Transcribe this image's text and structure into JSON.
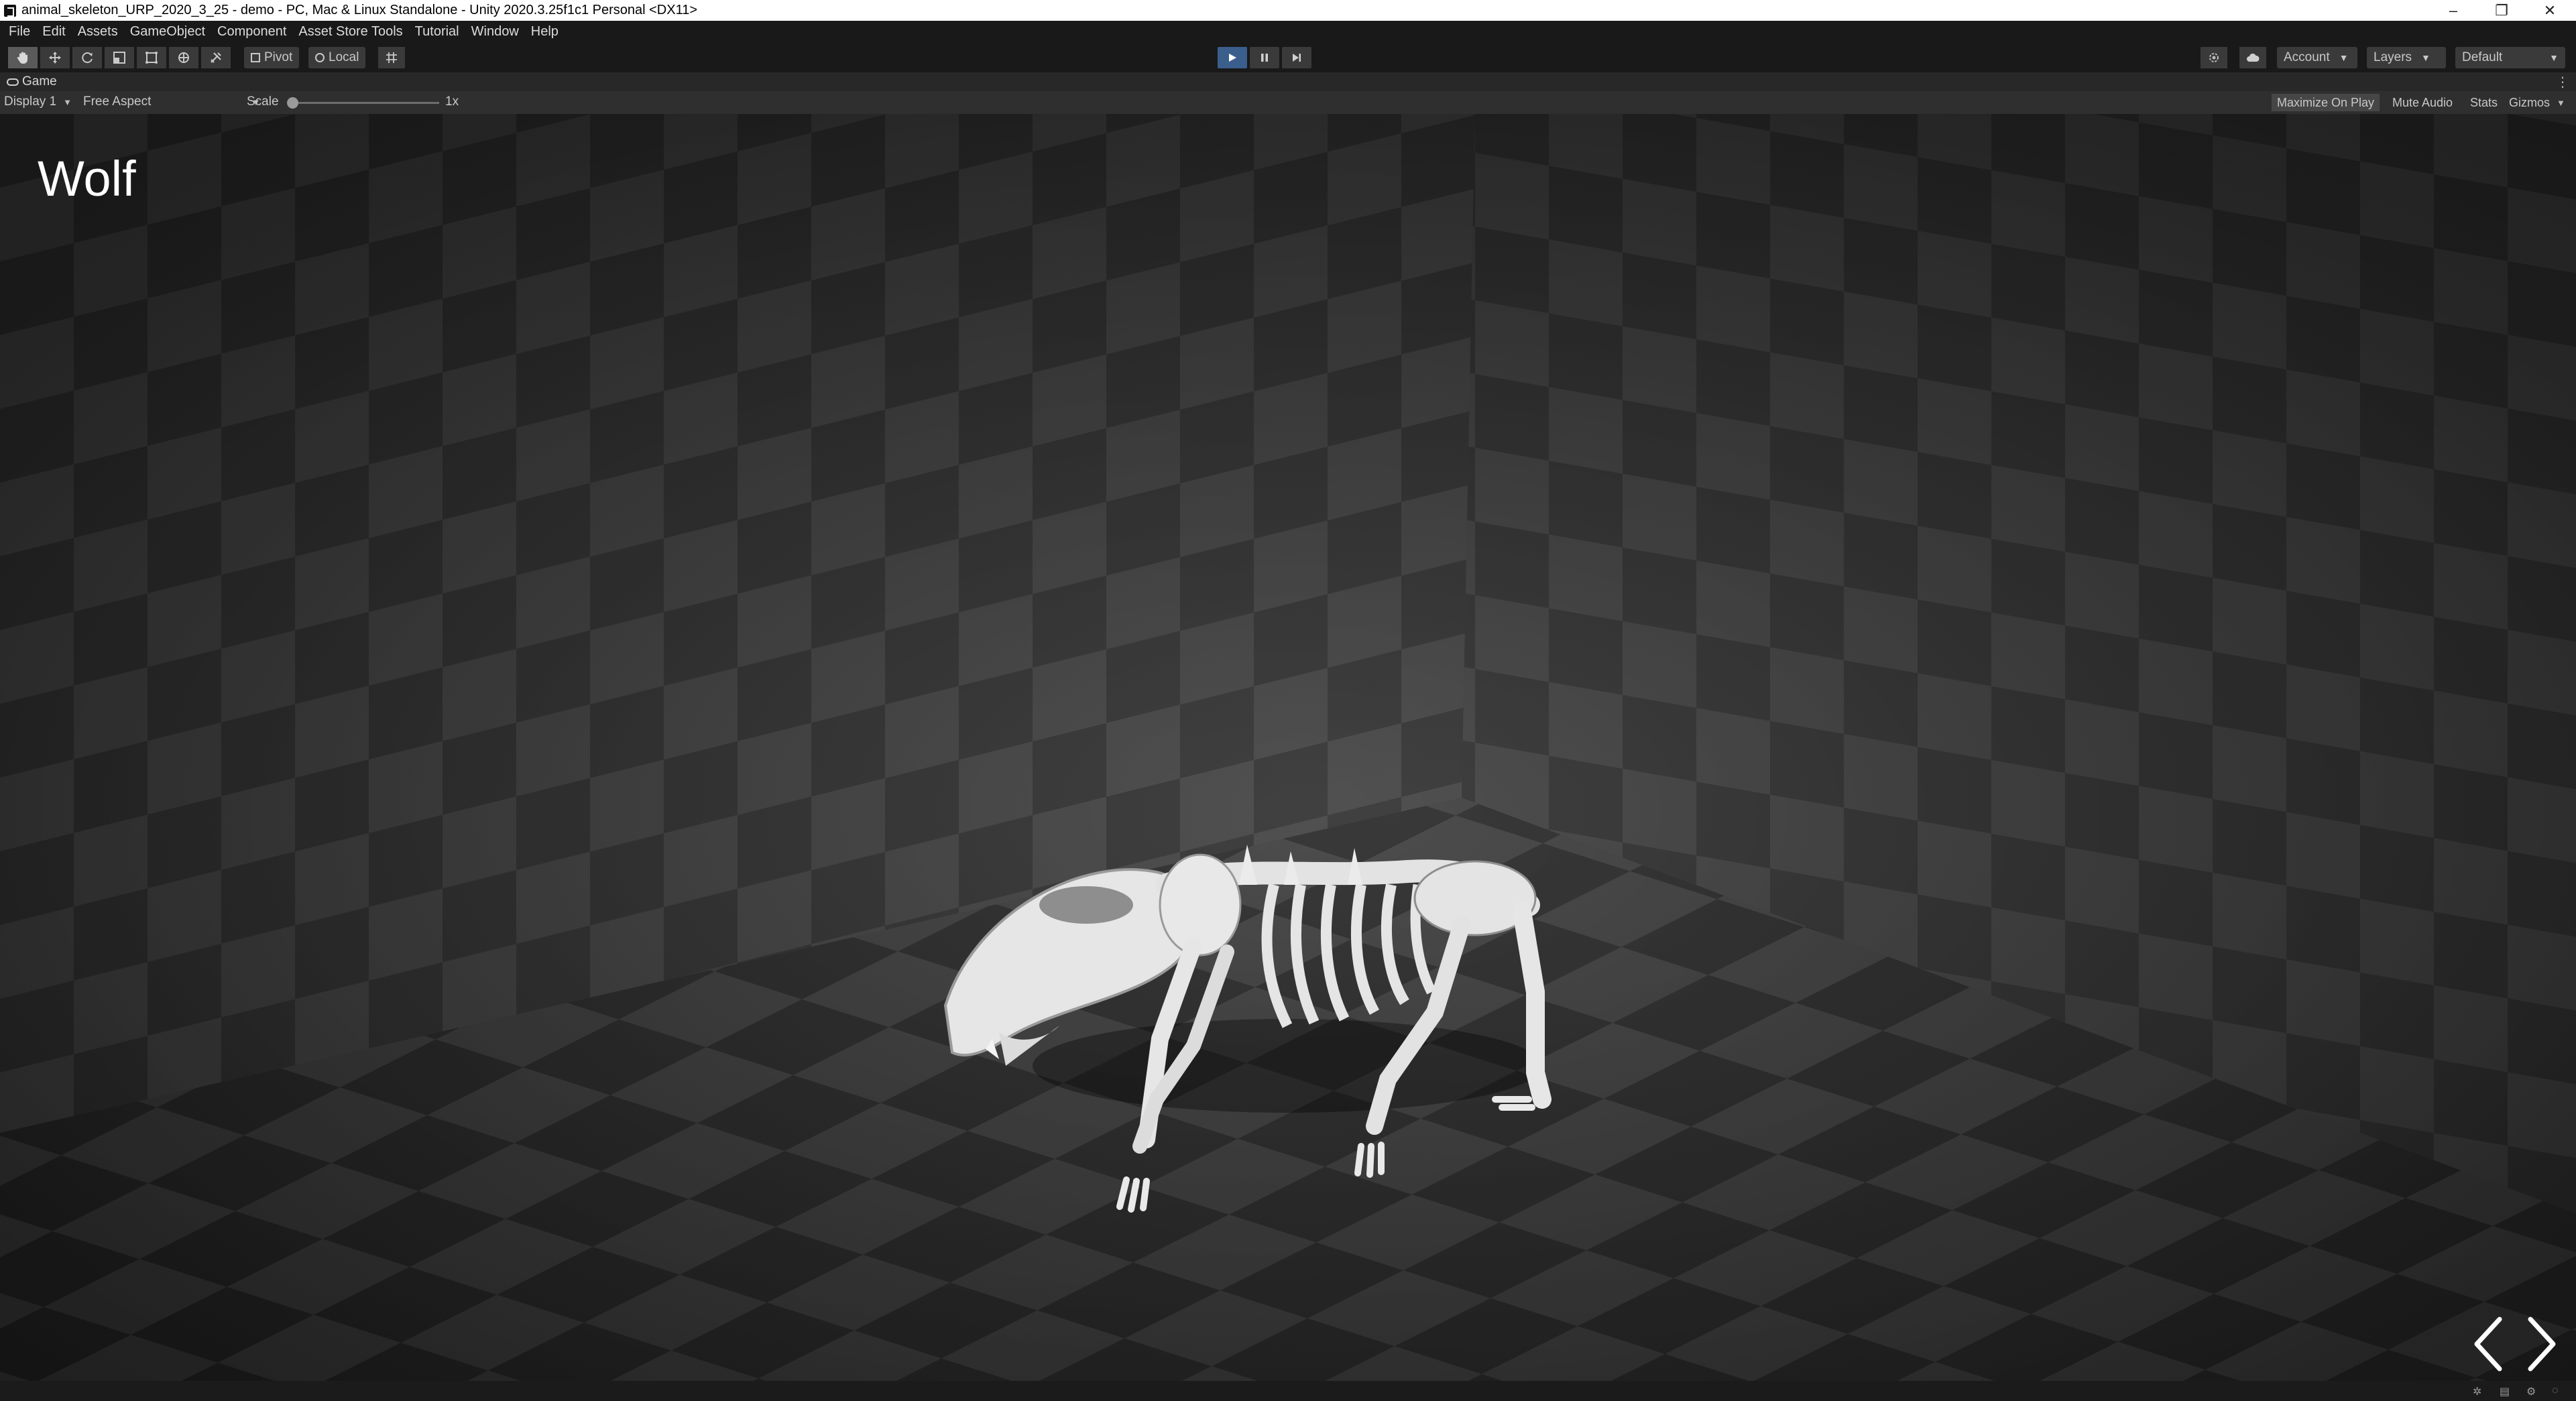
{
  "window": {
    "title": "animal_skeleton_URP_2020_3_25 - demo - PC, Mac & Linux Standalone - Unity 2020.3.25f1c1 Personal <DX11>",
    "controls": {
      "minimize": "–",
      "restore": "❐",
      "close": "✕"
    }
  },
  "menu": {
    "items": [
      "File",
      "Edit",
      "Assets",
      "GameObject",
      "Component",
      "Asset Store Tools",
      "Tutorial",
      "Window",
      "Help"
    ]
  },
  "toolbar": {
    "tools": [
      "hand-tool-icon",
      "move-tool-icon",
      "rotate-tool-icon",
      "scale-tool-icon",
      "rect-tool-icon",
      "transform-tool-icon",
      "custom-tool-icon"
    ],
    "pivot_label": "Pivot",
    "local_label": "Local",
    "account_label": "Account",
    "layers_label": "Layers",
    "layout_label": "Default",
    "play_state": "playing",
    "accent_color": "#3a5f8d"
  },
  "game_view": {
    "tab_label": "Game",
    "display_label": "Display 1",
    "aspect_label": "Free Aspect",
    "scale_label": "Scale",
    "scale_value": "1x",
    "maximize_on_play": "Maximize On Play",
    "mute_audio": "Mute Audio",
    "stats": "Stats",
    "gizmos": "Gizmos"
  },
  "scene": {
    "title": "Wolf",
    "prev_icon": "chevron-left-icon",
    "next_icon": "chevron-right-icon"
  }
}
